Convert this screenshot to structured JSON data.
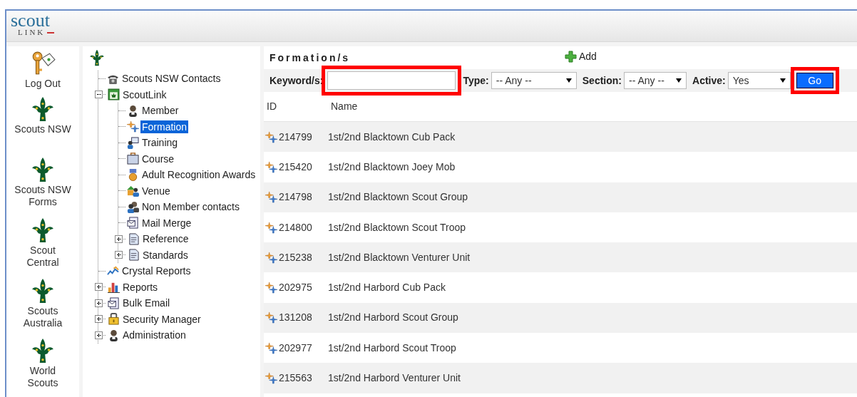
{
  "logo": {
    "top": "scout",
    "bottom": "LINK"
  },
  "nav": [
    {
      "label": "Log Out",
      "kind": "key"
    },
    {
      "label": "Scouts NSW",
      "kind": "fleur"
    },
    {
      "label": "Scouts NSW Forms",
      "kind": "fleur"
    },
    {
      "label": "Scout Central",
      "kind": "fleur"
    },
    {
      "label": "Scouts Australia",
      "kind": "fleur"
    },
    {
      "label": "World Scouts",
      "kind": "fleur"
    }
  ],
  "tree": {
    "kind": "fleur",
    "children": [
      {
        "label": "Scouts NSW Contacts",
        "kind": "phone",
        "selected": false
      },
      {
        "label": "ScoutLink",
        "kind": "scoutlink",
        "selected": false,
        "expanded": true,
        "children": [
          {
            "label": "Member",
            "kind": "person",
            "selected": false
          },
          {
            "label": "Formation",
            "kind": "formation",
            "selected": true
          },
          {
            "label": "Training",
            "kind": "training",
            "selected": false
          },
          {
            "label": "Course",
            "kind": "briefcase",
            "selected": false
          },
          {
            "label": "Adult Recognition Awards",
            "kind": "medal",
            "selected": false
          },
          {
            "label": "Venue",
            "kind": "venue",
            "selected": false
          },
          {
            "label": "Non Member contacts",
            "kind": "people",
            "selected": false
          },
          {
            "label": "Mail Merge",
            "kind": "mail",
            "selected": false
          },
          {
            "label": "Reference",
            "kind": "doc",
            "selected": false,
            "expanded": false
          },
          {
            "label": "Standards",
            "kind": "doc",
            "selected": false,
            "expanded": false
          }
        ]
      },
      {
        "label": "Crystal Reports",
        "kind": "chart",
        "selected": false
      },
      {
        "label": "Reports",
        "kind": "bars",
        "selected": false,
        "expanded": false
      },
      {
        "label": "Bulk Email",
        "kind": "mail",
        "selected": false,
        "expanded": false
      },
      {
        "label": "Security Manager",
        "kind": "lock",
        "selected": false,
        "expanded": false
      },
      {
        "label": "Administration",
        "kind": "person",
        "selected": false,
        "expanded": false
      }
    ]
  },
  "main": {
    "title": "Formation/s",
    "add": "Add",
    "filters": {
      "keyword": {
        "label": "Keyword/s:",
        "highlighted": true
      },
      "selects": [
        {
          "label": "Type:",
          "value": "-- Any --"
        },
        {
          "label": "Section:",
          "value": "-- Any --"
        },
        {
          "label": "Active:",
          "value": "Yes"
        }
      ],
      "go": {
        "label": "Go",
        "highlighted": true
      }
    },
    "columns": [
      "ID",
      "Name"
    ],
    "rows": [
      [
        "214799",
        "1st/2nd Blacktown Cub Pack"
      ],
      [
        "215420",
        "1st/2nd Blacktown Joey Mob"
      ],
      [
        "214798",
        "1st/2nd Blacktown Scout Group"
      ],
      [
        "214800",
        "1st/2nd Blacktown Scout Troop"
      ],
      [
        "215238",
        "1st/2nd Blacktown Venturer Unit"
      ],
      [
        "202975",
        "1st/2nd Harbord Cub Pack"
      ],
      [
        "131208",
        "1st/2nd Harbord Scout Group"
      ],
      [
        "202977",
        "1st/2nd Harbord Scout Troop"
      ],
      [
        "215563",
        "1st/2nd Harbord Venturer Unit"
      ]
    ]
  }
}
